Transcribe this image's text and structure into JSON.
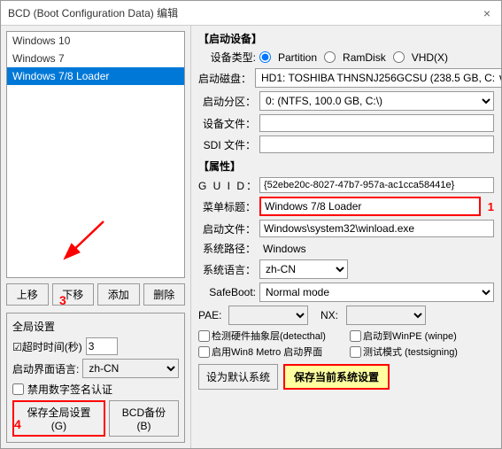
{
  "window": {
    "title": "BCD (Boot Configuration Data) 编辑",
    "close_btn": "×"
  },
  "left_panel": {
    "list_items": [
      {
        "label": "Windows 10",
        "selected": false
      },
      {
        "label": "Windows 7",
        "selected": false
      },
      {
        "label": "Windows 7/8 Loader",
        "selected": true
      }
    ],
    "btn_up": "上移",
    "btn_down": "下移",
    "btn_add": "添加",
    "btn_del": "删除",
    "global_settings_title": "全局设置",
    "timeout_label": "☑超时时间(秒)",
    "timeout_value": "3",
    "ui_lang_label": "启动界面语言:",
    "ui_lang_value": "zh-CN",
    "no_sign_label": "禁用数字签名认证",
    "btn_save_global": "保存全局设置(G)",
    "btn_bcd_backup": "BCD备份(B)"
  },
  "right_panel": {
    "boot_device_title": "【启动设备】",
    "device_type_label": "设备类型:",
    "partition_option": "Partition",
    "ramdisk_option": "RamDisk",
    "vhd_option": "VHD(X)",
    "boot_disk_label": "启动磁盘：",
    "boot_disk_value": "HD1: TOSHIBA THNSNJ256GCSU (238.5 GB, C: ∨",
    "boot_partition_label": "启动分区：",
    "boot_partition_value": "0: (NTFS, 100.0 GB, C:\\)",
    "device_file_label": "设备文件：",
    "device_file_value": "",
    "sdi_file_label": "SDI 文件：",
    "sdi_file_value": "",
    "properties_title": "【属性】",
    "guid_label": "G U I D：",
    "guid_value": "{52ebe20c-8027-47b7-957a-ac1cca58441e}",
    "menu_title_label": "菜单标题：",
    "menu_title_value": "Windows 7/8 Loader",
    "boot_file_label": "启动文件：",
    "boot_file_value": "Windows\\system32\\winload.exe",
    "sys_path_label": "系统路径：",
    "sys_path_value": "Windows",
    "sys_lang_label": "系统语言：",
    "sys_lang_value": "zh-CN",
    "safeboot_label": "SafeBoot:",
    "safeboot_value": "Normal mode",
    "pae_label": "PAE:",
    "pae_value": "",
    "nx_label": "NX:",
    "nx_value": "",
    "detect_hal_label": "检测硬件抽象层(detecthal)",
    "winpe_label": "启动到WinPE (winpe)",
    "win8metro_label": "启用Win8 Metro 启动界面",
    "testsigning_label": "测试模式 (testsigning)",
    "btn_set_default": "设为默认系统",
    "btn_save_current": "保存当前系统设置",
    "marker_1": "1"
  },
  "annotations": {
    "num3": "3",
    "num4": "4"
  }
}
